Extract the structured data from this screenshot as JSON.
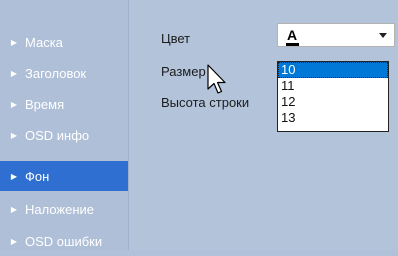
{
  "sidebar": {
    "items": [
      {
        "label": "Маска",
        "active": false
      },
      {
        "label": "Заголовок",
        "active": false
      },
      {
        "label": "Время",
        "active": false
      },
      {
        "label": "OSD инфо",
        "active": false
      },
      {
        "label": "Фон",
        "active": true
      },
      {
        "label": "Наложение",
        "active": false
      },
      {
        "label": "OSD ошибки",
        "active": false
      }
    ]
  },
  "form": {
    "color_label": "Цвет",
    "color_value": "A",
    "size_label": "Размер",
    "line_height_label": "Высота строки",
    "size_options": [
      "10",
      "11",
      "12",
      "13"
    ],
    "size_selected": "10"
  },
  "colors": {
    "sidebar_active": "#2e6fd1",
    "background": "#b2c3da",
    "list_selection": "#0078d7"
  }
}
